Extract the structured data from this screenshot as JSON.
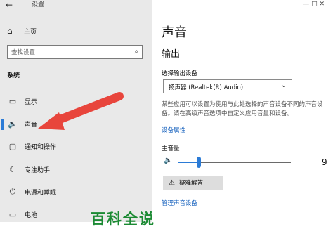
{
  "window": {
    "title": "设置",
    "controls": "—   □   ✕"
  },
  "sidebar": {
    "back_glyph": "←",
    "home_label": "主页",
    "search_placeholder": "查找设置",
    "section_heading": "系统",
    "items": [
      {
        "label": "显示",
        "icon": "monitor-icon",
        "glyph": "▭"
      },
      {
        "label": "声音",
        "icon": "speaker-icon",
        "glyph": "🔈",
        "selected": true
      },
      {
        "label": "通知和操作",
        "icon": "notification-icon",
        "glyph": "▢"
      },
      {
        "label": "专注助手",
        "icon": "moon-icon",
        "glyph": "☾"
      },
      {
        "label": "电源和睡眠",
        "icon": "power-icon",
        "glyph": "⏻"
      },
      {
        "label": "电池",
        "icon": "battery-icon",
        "glyph": "▭"
      }
    ]
  },
  "main": {
    "title": "声音",
    "output_heading": "输出",
    "choose_output_label": "选择输出设备",
    "output_device": "扬声器 (Realtek(R) Audio)",
    "description": "某些应用可以设置为使用与此处选择的声音设备不同的声音设备。请在高级声音选项中自定义应用音量和设备。",
    "device_properties_link": "设备属性",
    "master_volume_label": "主音量",
    "volume_value": "9",
    "volume_fraction": 0.09,
    "troubleshoot_label": "疑难解答",
    "manage_devices_link": "管理声音设备"
  },
  "overlay": {
    "watermark": "百科全说",
    "arrow_color": "#e8453c",
    "accent": "#2b7bd6",
    "watermark_color": "#1b8a33"
  }
}
